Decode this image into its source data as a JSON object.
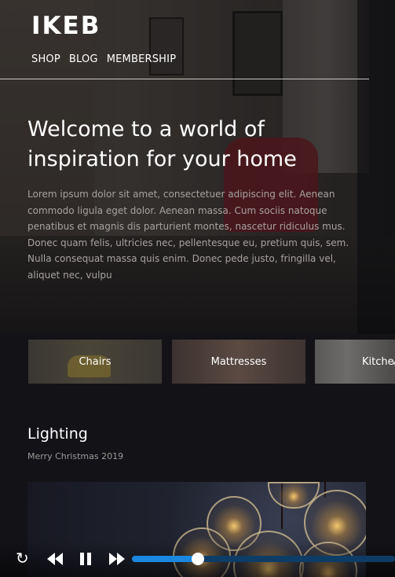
{
  "brand": {
    "logo": "IKEB"
  },
  "nav": {
    "items": [
      "SHOP",
      "BLOG",
      "MEMBERSHIP"
    ]
  },
  "hero": {
    "headline_line1": "Welcome to a world of",
    "headline_line2": "inspiration for your home",
    "body": "Lorem ipsum dolor sit amet, consectetuer adipiscing elit. Aenean commodo ligula eget dolor. Aenean massa. Cum sociis natoque penatibus et magnis dis parturient montes, nascetur ridiculus mus. Donec quam felis, ultricies nec, pellentesque eu, pretium quis, sem. Nulla consequat massa quis enim. Donec pede justo, fringilla vel, aliquet nec, vulpu"
  },
  "categories": [
    "Chairs",
    "Mattresses",
    "Kitche"
  ],
  "section": {
    "title": "Lighting",
    "subtitle": "Merry Christmas 2019"
  },
  "player": {
    "progress_fraction": 0.25,
    "icons": {
      "replay": "replay-icon",
      "rewind": "rewind-icon",
      "pause": "pause-icon",
      "forward": "fast-forward-icon",
      "move": "move-icon"
    },
    "colors": {
      "track": "#0d3d66",
      "fill": "#1a88e0",
      "knob": "#ffffff"
    }
  }
}
